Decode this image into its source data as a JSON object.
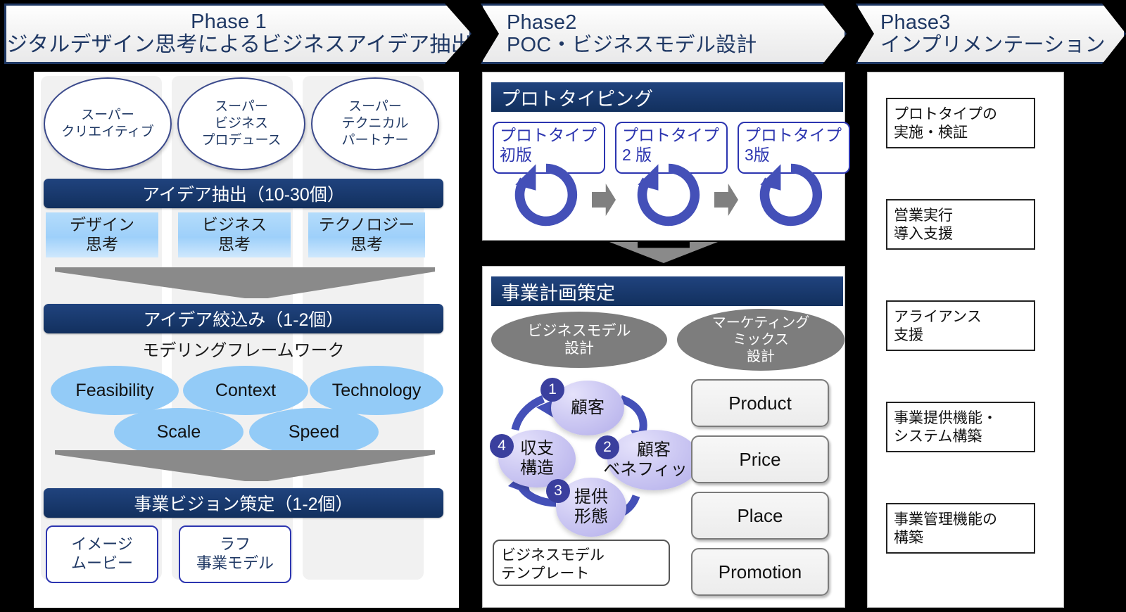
{
  "phases": [
    {
      "id": "phase1",
      "line1": "Phase 1",
      "line2": "デジタルデザイン思考によるビジネスアイデア抽出"
    },
    {
      "id": "phase2",
      "line1": "Phase2",
      "line2": "POC・ビジネスモデル設計"
    },
    {
      "id": "phase3",
      "line1": "Phase3",
      "line2": "インプリメンテーション"
    }
  ],
  "phase1": {
    "roles": [
      {
        "line1": "スーパー",
        "line2": "クリエイティブ"
      },
      {
        "line1": "スーパー",
        "line2": "ビジネス",
        "line3": "プロデュース"
      },
      {
        "line1": "スーパー",
        "line2": "テクニカル",
        "line3": "パートナー"
      }
    ],
    "bar_extract": "アイデア抽出（10-30個）",
    "thinking": [
      {
        "line1": "デザイン",
        "line2": "思考"
      },
      {
        "line1": "ビジネス",
        "line2": "思考"
      },
      {
        "line1": "テクノロジー",
        "line2": "思考"
      }
    ],
    "bar_narrow": "アイデア絞込み（1-2個）",
    "framework_label": "モデリングフレームワーク",
    "criteria": [
      "Feasibility",
      "Context",
      "Technology",
      "Scale",
      "Speed"
    ],
    "bar_vision": "事業ビジョン策定（1-2個）",
    "outputs": [
      {
        "line1": "イメージ",
        "line2": "ムービー"
      },
      {
        "line1": "ラフ",
        "line2": "事業モデル"
      }
    ]
  },
  "phase2": {
    "prototyping": {
      "header": "プロトタイピング",
      "boxes": [
        {
          "line1": "プロトタイプ",
          "line2": "初版"
        },
        {
          "line1": "プロトタイプ",
          "line2": "2 版"
        },
        {
          "line1": "プロトタイプ",
          "line2": "3版"
        }
      ]
    },
    "plan": {
      "header": "事業計画策定",
      "group_bm": {
        "line1": "ビジネスモデル",
        "line2": "設計"
      },
      "group_mm": {
        "line1": "マーケティング",
        "line2": "ミックス",
        "line3": "設計"
      },
      "cycle": [
        {
          "num": "1",
          "label": "顧客"
        },
        {
          "num": "2",
          "line1": "顧客",
          "line2": "ベネフィット"
        },
        {
          "num": "3",
          "line1": "提供",
          "line2": "形態"
        },
        {
          "num": "4",
          "line1": "収支",
          "line2": "構造"
        }
      ],
      "template": {
        "line1": "ビジネスモデル",
        "line2": "テンプレート"
      },
      "marketing_mix": [
        "Product",
        "Price",
        "Place",
        "Promotion"
      ]
    }
  },
  "phase3": {
    "items": [
      {
        "line1": "プロトタイプの",
        "line2": "実施・検証"
      },
      {
        "line1": "営業実行",
        "line2": "導入支援"
      },
      {
        "line1": "アライアンス",
        "line2": "支援"
      },
      {
        "line1": "事業提供機能・",
        "line2": "システム構築"
      },
      {
        "line1": "事業管理機能の",
        "line2": "構築"
      }
    ]
  },
  "colors": {
    "navy": "#1F3864",
    "navy_bar": "#12305e",
    "light_blue": "#93cbf7",
    "chip_blue": "#9ed0fa",
    "royal_blue": "#2c35b0",
    "cycle_arrow": "#4450b8",
    "gray_ellipse": "#7d7d7d",
    "funnel_gray": "#8a8a8a",
    "lilac": "#cdc9f3",
    "badge": "#3a3f9e",
    "panel_gray": "#f1f1f1",
    "background": "#000000"
  }
}
